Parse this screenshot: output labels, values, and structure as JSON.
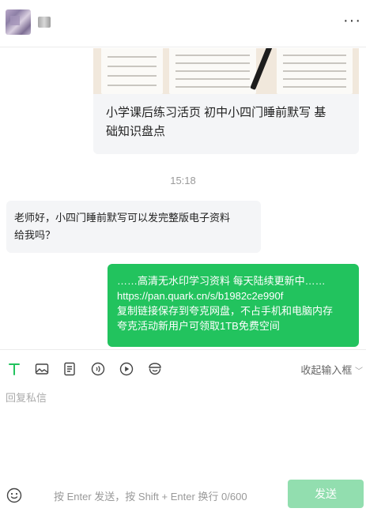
{
  "header": {
    "more_label": "···"
  },
  "chat": {
    "card": {
      "title_line1": "小学课后练习活页 初中小四门睡前默写 基",
      "title_line2": "础知识盘点"
    },
    "timestamp": "15:18",
    "incoming": {
      "line1": "老师好，小四门睡前默写可以发完整版电子资料",
      "line2": "给我吗？"
    },
    "outgoing": {
      "line1": "……高清无水印学习资料 每天陆续更新中……",
      "line2": "https://pan.quark.cn/s/b1982c2e990f",
      "line3": "复制链接保存到夸克网盘，不占手机和电脑内存",
      "line4": "夸克活动新用户可领取1TB免费空间"
    }
  },
  "composer": {
    "collapse_label": "收起输入框",
    "reply_placeholder": "回复私信",
    "hint": "按 Enter 发送，按 Shift + Enter 换行  0/600",
    "send_label": "发送",
    "icons": [
      "text-format-icon",
      "image-icon",
      "document-icon",
      "voice-icon",
      "video-icon",
      "sticker-icon"
    ]
  },
  "colors": {
    "accent_green": "#22c35e",
    "send_disabled": "#92deaf",
    "text_tool_active": "#22c35e"
  }
}
